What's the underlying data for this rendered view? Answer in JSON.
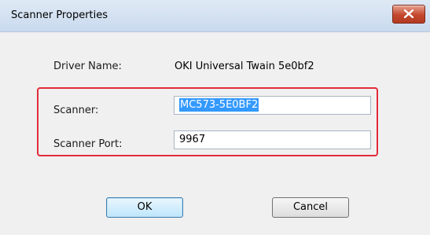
{
  "window": {
    "title": "Scanner Properties"
  },
  "fields": {
    "driver_name_label": "Driver Name:",
    "driver_name_value": "OKI Universal Twain 5e0bf2",
    "scanner_label": "Scanner:",
    "scanner_value": "MC573-5E0BF2",
    "scanner_port_label": "Scanner Port:",
    "scanner_port_value": "9967"
  },
  "buttons": {
    "ok_label": "OK",
    "cancel_label": "Cancel"
  },
  "colors": {
    "highlight_border": "#e32b3a",
    "selection": "#3399ff",
    "close_button": "#c3472c"
  },
  "icons": {
    "close": "close-icon"
  }
}
